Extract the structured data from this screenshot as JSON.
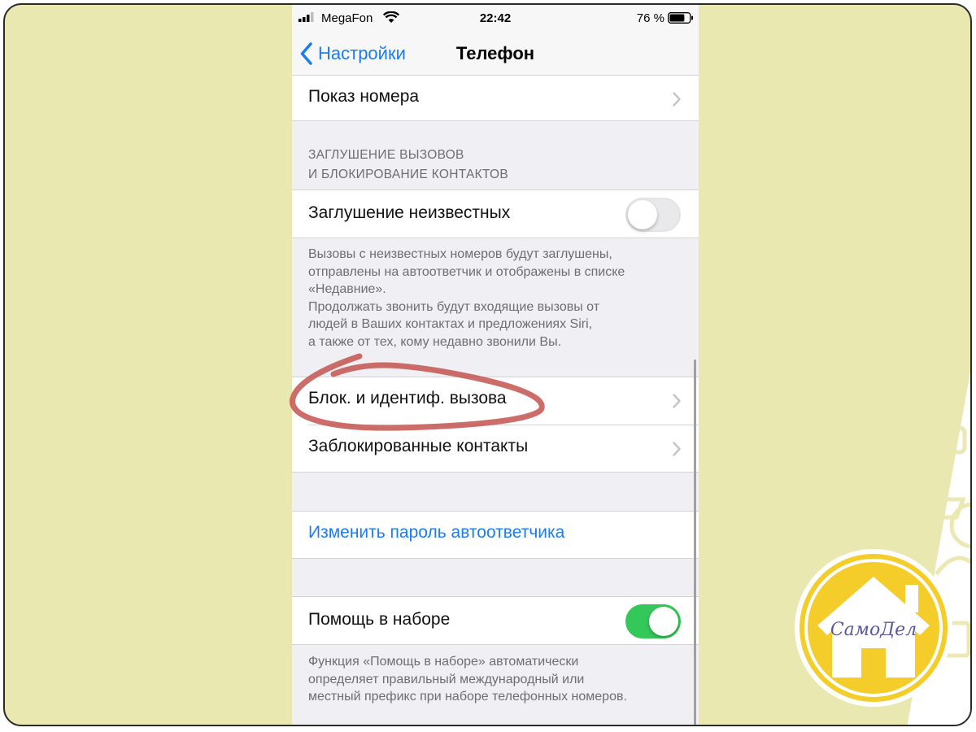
{
  "status_bar": {
    "carrier": "MegaFon",
    "time": "22:42",
    "battery": "76 %",
    "battery_level": 0.76
  },
  "nav": {
    "back_label": "Настройки",
    "title": "Телефон"
  },
  "cells": {
    "caller_id": "Показ номера",
    "silence_unknown": "Заглушение неизвестных",
    "block_identify": "Блок. и идентиф. вызова",
    "blocked_contacts": "Заблокированные контакты",
    "change_voicemail_password": "Изменить пароль автоответчика",
    "dial_assist": "Помощь в наборе"
  },
  "toggles": {
    "silence_unknown_on": false,
    "dial_assist_on": true
  },
  "section_header": {
    "line1": "ЗАГЛУШЕНИЕ ВЫЗОВОВ",
    "line2": "И БЛОКИРОВАНИЕ КОНТАКТОВ"
  },
  "silence_footer": [
    "Вызовы с неизвестных номеров будут заглушены,",
    "отправлены на автоответчик и отображены в списке",
    "«Недавние».",
    "Продолжать звонить будут входящие вызовы от",
    "людей в Ваших контактах и предложениях Siri,",
    "а также от тех, кому недавно звонили Вы."
  ],
  "dial_assist_footer": [
    "Функция «Помощь в наборе» автоматически",
    "определяет правильный международный или",
    "местный префикс при наборе телефонных номеров."
  ],
  "logo": {
    "text": "СамоДел"
  },
  "colors": {
    "ios_blue": "#1b7cf4",
    "toggle_green": "#34c759",
    "annotation_red": "#c4544f",
    "logo_yellow": "#f5cd2a",
    "background_yellow": "#e9e8b0"
  }
}
